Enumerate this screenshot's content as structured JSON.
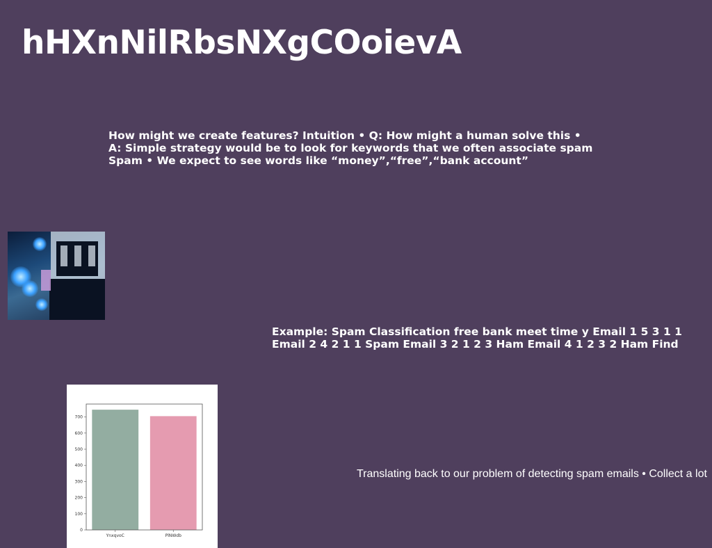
{
  "slide": {
    "title": "hHXnNilRbsNXgCOoievA",
    "text_block_1": "How might we create features? Intuition • Q: How might a human solve this • A: Simple strategy would be to look for keywords that we often associate spam Spam • We expect to see words like “money”,“free”,“bank account”",
    "text_block_2": "Example: Spam Classification free bank meet time y Email 1 5 3 1 1 Email 2 4 2 1 1 Spam Email 3 2 1 2 3 Ham Email 4 1 2 3 2 Ham Find",
    "text_block_3": "Translating back to our problem of detecting spam emails • Collect a lot"
  },
  "colors": {
    "background": "#4f3f5d",
    "bar_1": "#93ada1",
    "bar_2": "#e59bb0"
  },
  "chart_data": {
    "type": "bar",
    "categories": [
      "YnxqvoC",
      "PlNWdb"
    ],
    "values": [
      745,
      705
    ],
    "ylim": [
      0,
      780
    ],
    "yticks": [
      0,
      100,
      200,
      300,
      400,
      500,
      600,
      700
    ],
    "grid": false
  }
}
